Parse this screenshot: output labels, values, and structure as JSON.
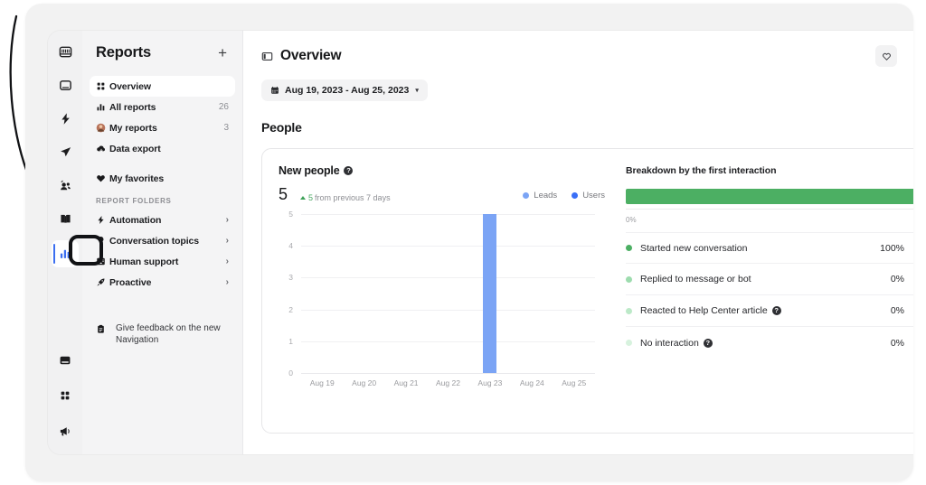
{
  "icon_rail": {
    "items": [
      {
        "name": "inbox-icon",
        "label": "Inbox"
      },
      {
        "name": "conversations-icon",
        "label": "Conversations"
      },
      {
        "name": "automation-bolt-icon",
        "label": "Automation"
      },
      {
        "name": "outbound-send-icon",
        "label": "Outbound"
      },
      {
        "name": "contacts-people-icon",
        "label": "Contacts"
      },
      {
        "name": "knowledge-book-icon",
        "label": "Knowledge"
      },
      {
        "name": "reports-bar-icon",
        "label": "Reports"
      }
    ],
    "bottom_items": [
      {
        "name": "messenger-icon",
        "label": "Messenger"
      },
      {
        "name": "apps-grid-icon",
        "label": "Apps"
      },
      {
        "name": "news-megaphone-icon",
        "label": "News"
      }
    ]
  },
  "sidebar": {
    "title": "Reports",
    "add_label": "+",
    "items": [
      {
        "label": "Overview",
        "icon": "grid-icon",
        "count": "",
        "chevron": "",
        "selected": true
      },
      {
        "label": "All reports",
        "icon": "bar-chart-icon",
        "count": "26",
        "chevron": "",
        "selected": false
      },
      {
        "label": "My reports",
        "icon": "avatar-icon",
        "count": "3",
        "chevron": "",
        "selected": false
      },
      {
        "label": "Data export",
        "icon": "cloud-download-icon",
        "count": "",
        "chevron": "",
        "selected": false
      }
    ],
    "favorites": {
      "label": "My favorites",
      "icon": "heart-icon"
    },
    "folders_label": "REPORT FOLDERS",
    "folders": [
      {
        "label": "Automation",
        "icon": "bolt-icon",
        "chevron": "›"
      },
      {
        "label": "Conversation topics",
        "icon": "lightbulb-icon",
        "chevron": "›"
      },
      {
        "label": "Human support",
        "icon": "support-agent-icon",
        "chevron": "›"
      },
      {
        "label": "Proactive",
        "icon": "rocket-icon",
        "chevron": "›"
      }
    ],
    "feedback": {
      "label": "Give feedback on the new Navigation",
      "icon": "clipboard-icon"
    }
  },
  "main": {
    "page_title": "Overview",
    "panel_toggle_icon": "panel-toggle-icon",
    "favorite_icon": "heart-outline-icon",
    "date_range": "Aug 19, 2023 - Aug 25, 2023",
    "date_caret": "▾",
    "section_title": "People"
  },
  "card": {
    "title": "New people",
    "help_glyph": "?",
    "metric_value": "5",
    "delta_value": "5",
    "delta_suffix": "from previous 7 days",
    "legend": [
      {
        "label": "Leads",
        "color": "#7ba4f5"
      },
      {
        "label": "Users",
        "color": "#3a6ff7"
      }
    ]
  },
  "chart_data": {
    "type": "bar",
    "title": "New people",
    "categories": [
      "Aug 19",
      "Aug 20",
      "Aug 21",
      "Aug 22",
      "Aug 23",
      "Aug 24",
      "Aug 25"
    ],
    "series": [
      {
        "name": "Leads",
        "color": "#7ba4f5",
        "values": [
          0,
          0,
          0,
          0,
          5,
          0,
          0
        ]
      },
      {
        "name": "Users",
        "color": "#3a6ff7",
        "values": [
          0,
          0,
          0,
          0,
          0,
          0,
          0
        ]
      }
    ],
    "xlabel": "",
    "ylabel": "",
    "ylim": [
      0,
      5
    ],
    "yticks": [
      5,
      4,
      3,
      2,
      1,
      0
    ],
    "grid": true,
    "legend_position": "top-right"
  },
  "breakdown": {
    "title": "Breakdown by the first interaction",
    "axis_zero_label": "0%",
    "stacked": [
      {
        "label": "Started new conversation",
        "pct": 100,
        "color": "#4caf63"
      }
    ],
    "rows": [
      {
        "label": "Started new conversation",
        "color": "#4caf63",
        "pct": "100%",
        "trend": "…",
        "trend_up": true,
        "help": false
      },
      {
        "label": "Replied to message or bot",
        "color": "#9ddcae",
        "pct": "0%",
        "trend": "—",
        "trend_up": false,
        "help": false
      },
      {
        "label": "Reacted to Help Center article",
        "color": "#bce9c8",
        "pct": "0%",
        "trend": "—",
        "trend_up": false,
        "help": true
      },
      {
        "label": "No interaction",
        "color": "#d7f2de",
        "pct": "0%",
        "trend": "—",
        "trend_up": false,
        "help": true
      }
    ],
    "help_glyph": "?"
  },
  "annotations": {
    "arrow": "curved-arrow-pointing-to-reports-icon",
    "highlight_box": "black-rounded-rect-around-reports-rail-icon"
  },
  "colors": {
    "accent_blue": "#3b6ef0",
    "bar_blue": "#7ba4f5",
    "green": "#4caf63",
    "frame_bg": "#f2f2f2",
    "sidebar_bg": "#f4f4f5"
  }
}
